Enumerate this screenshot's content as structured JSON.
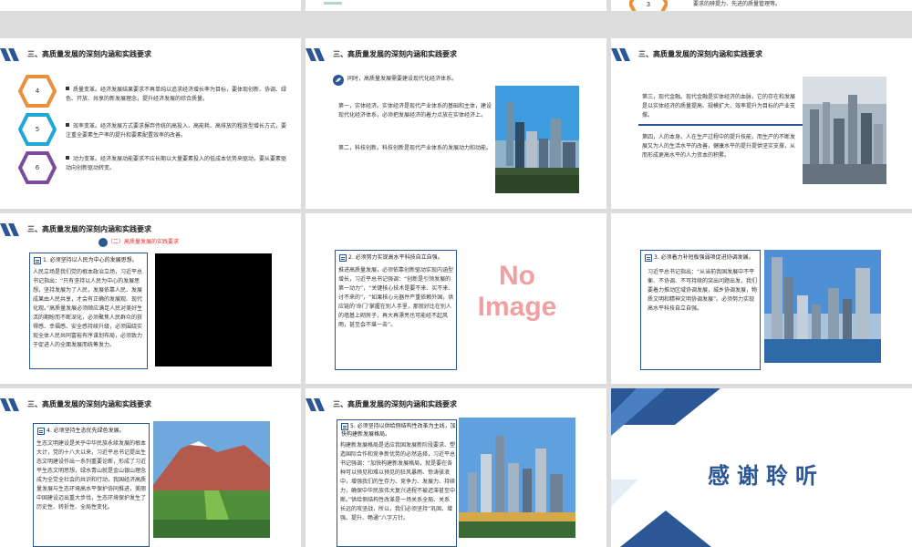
{
  "header_title": "三、高质量发展的深刻内涵和实践要求",
  "top_slide": {
    "hex_number": "3",
    "text": "要求的辨提力、先进的质量管理等。"
  },
  "slide_hex": {
    "items": [
      {
        "number": "4",
        "text": "质量变革。经济发展结果要求不再单纯以追求经济增长率为目标，要体现创新、协调、绿色、开放、共享的新发展理念，提升经济发展的综合质量。"
      },
      {
        "number": "5",
        "text": "效率变革。经济发展方式要求摒弃传统的高投入、高能耗、高排放的粗放型增长方式，要注重全要素生产率的提升和要素配置效率的改善。"
      },
      {
        "number": "6",
        "text": "动力变革。经济发展动能要求不应长期以大量要素投入的低成本优势来驱动，要从要素驱动向创新驱动转变。"
      }
    ]
  },
  "slide_system": {
    "intro": "同时，高质量发展需要建设现代化经济体系。",
    "p1": "第一，实体经济。实体经济是现代产业体系的基础和主体，建设现代化经济体系，必须把发展经济的着力点放在实体经济上。",
    "p2": "第二，科技创新。科技创新是现代产业体系的发展动力和动能。"
  },
  "slide_finance": {
    "p3": "第三，现代金融。现代金融是实体经济的血脉，它的存在和发展是以实体经济的质量提高、规模扩大、效率提升为目标的产业支撑。",
    "p4": "第四，人的本身。人在生产过程中的提升技能，而生产的不断发展又为人的生活水平的改善，健康水平的提升提供坚实支撑，从而形成更高水平的人力资本的积累。"
  },
  "slide_people": {
    "subtitle": "（二）高质量发展的实践要求",
    "box_head": "1. 必须坚持以人民为中心的发展思想。",
    "body": "人民立场是我们党的根本政治立场，习近平总书记指出：“只有坚持以人民为中心的发展思想，坚持发展为了人民，发展依靠人民、发展成果由人民共享，才会有正确的发展观、现代化观。”高质量发展必须顺应满足人民对美好生活的期盼而不断深化，必须聚焦人民群众的获得感、幸福感、安全感持续升级，必须围绕实现全体人民共同富裕有序谋划布局，必须致力于促进人的全面发展而统筹发力。"
  },
  "slide_tech": {
    "box_head": "2. 必须努力实现高水平科技自立自强。",
    "body": "推进高质量发展，必须依靠创新驱动实现内涵型增长，习近平总书记强调：“创新是引领发展的第一动力”，“关键核心技术是要不来、买不来、讨不来的”，“如果核心元器件严重依赖外国，供应链的‘命门’掌握在别人手里，那就好比在别人的墙基上砌房子，再大再漂亮也可能经不起风雨，甚至会不堪一击”。",
    "placeholder_line1": "No",
    "placeholder_line2": "Image"
  },
  "slide_region": {
    "box_head": "3. 必须着力补短板强弱项促进协调发展。",
    "body": "习近平总书记指出：“从当前我国发展中不平衡、不协调、不可持续的突出问题出发，我们要着力推动区域协调发展，城乡协调发展，物质文明和精神文明协调发展”。必须努力实现高水平科技自立自强。"
  },
  "slide_green": {
    "box_head": "4. 必须坚持生态优先绿色发展。",
    "body": "生态文明建设是关乎中华民族永续发展的根本大计，党的十八大以来，习近平总书记提出生态文明建设作出一系列重要论断，形成了习近平生态文明思想，绿水青山就是金山银山理念成为全党全社会的共识和行动，我国经济高质量发展与生态环境高水平保护协同推进，美丽中国建设迈出重大步伐，生态环境保护发生了历史性、转折性、全局性变化。"
  },
  "slide_reform": {
    "box_head": "5. 必须坚持以供给侧结构性改革为主线，加快构建新发展格局。",
    "body": "构建新发展格局是适应我国发展新阶段要求、塑造国际合作和竞争新优势的必然选择，习近平总书记强调：“加快构建新发展格局，就是要在各种可以预见和难以预见的狂风暴雨、惊涛骇浪中，增强我们的生存力、竞争力、发展力、持续力，确保中华民族伟大复兴进程不被迟滞甚至中断。”供给侧结构性改革是一场关系全局、关系长远的攻坚战，所以，我们必须坚持“巩固、增强、提升、畅通”八字方针。"
  },
  "slide_thanks": {
    "title": "感谢聆听"
  },
  "colors": {
    "accent_blue": "#2b5797",
    "hex_orange": "#e8913a",
    "hex_cyan": "#1fa7d8",
    "hex_purple": "#7e4aa0",
    "subtitle_red": "#d9312b"
  }
}
